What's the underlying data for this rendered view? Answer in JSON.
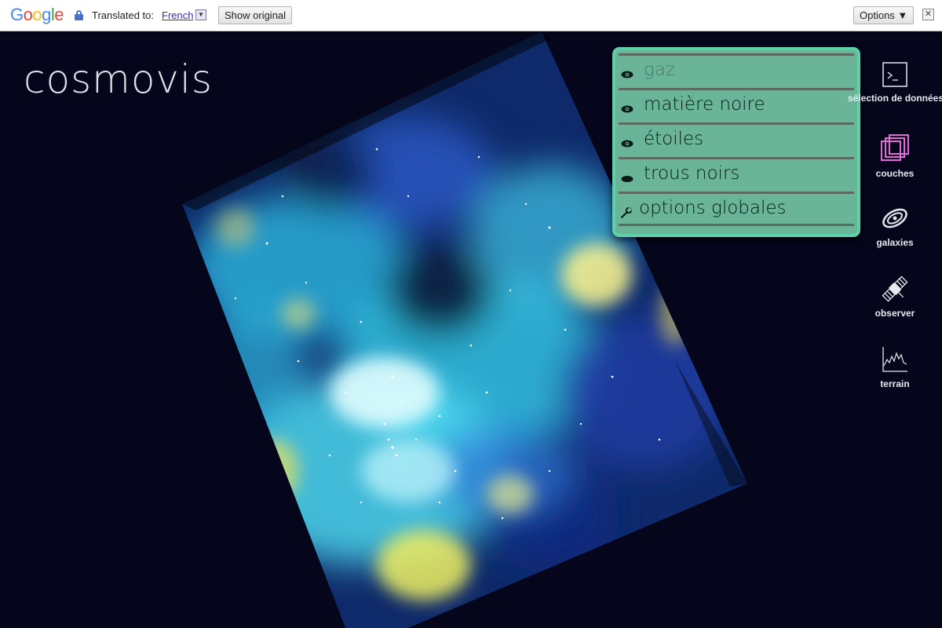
{
  "translate_bar": {
    "logo": "Google",
    "translated_to": "Translated to:",
    "language": "French",
    "show_original": "Show original",
    "options": "Options ▼",
    "close": "✕"
  },
  "app": {
    "title": "cosmovis"
  },
  "layers": [
    {
      "label": "gaz",
      "icon": "eye-icon"
    },
    {
      "label": "matière noire",
      "icon": "eye-icon"
    },
    {
      "label": "étoiles",
      "icon": "eye-icon"
    },
    {
      "label": "trous noirs",
      "icon": "eye-closed-icon"
    },
    {
      "label": "options globales",
      "icon": "wrench-icon"
    }
  ],
  "toolbar": [
    {
      "label": "sélection de données",
      "icon": "terminal-icon"
    },
    {
      "label": "couches",
      "icon": "layers-icon"
    },
    {
      "label": "galaxies",
      "icon": "galaxy-icon"
    },
    {
      "label": "observer",
      "icon": "satellite-icon"
    },
    {
      "label": "terrain",
      "icon": "terrain-icon"
    }
  ],
  "colors": {
    "background": "#05051c",
    "panel": "#6ab49a",
    "panel_border": "#5ed0a8",
    "layers_icon": "#e36bd6"
  }
}
